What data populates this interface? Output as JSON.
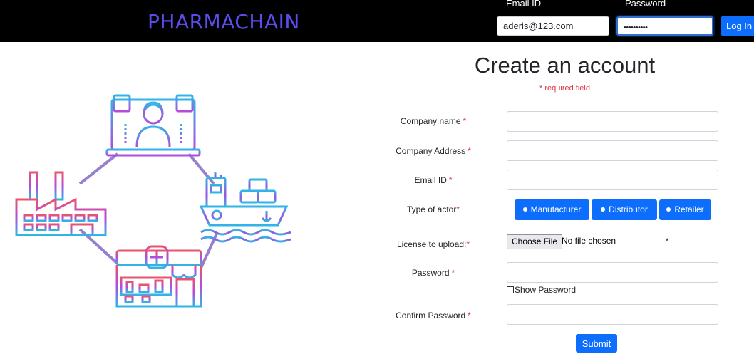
{
  "navbar": {
    "brand": "PHARMACHAIN",
    "email_label": "Email ID",
    "email_value": "aderis@123.com",
    "password_label": "Password",
    "password_value": "••••••••••",
    "login_label": "Log In"
  },
  "form": {
    "title": "Create an account",
    "required_note": "* required field",
    "fields": {
      "company_name": {
        "label": "Company name",
        "star": "*"
      },
      "company_address": {
        "label": "Company Address",
        "star": "*"
      },
      "email": {
        "label": "Email ID",
        "star": "*"
      },
      "actor": {
        "label": "Type of actor",
        "star": "*",
        "options": [
          "Manufacturer",
          "Distributor",
          "Retailer"
        ]
      },
      "license": {
        "label": "License to upload:",
        "star": "*",
        "choose_label": "Choose File",
        "status": "No file chosen",
        "side_star": "*"
      },
      "password": {
        "label": "Password",
        "star": "*",
        "show_label": "Show Password"
      },
      "confirm_password": {
        "label": "Confirm Password",
        "star": "*"
      }
    },
    "submit_label": "Submit"
  },
  "colors": {
    "primary": "#0d6efd",
    "brand": "#5b4cf0",
    "required": "#dc3545",
    "navbar_bg": "#000000"
  },
  "illustration": {
    "icons": [
      "customer-support-icon",
      "factory-icon",
      "cargo-ship-icon",
      "pharmacy-store-icon"
    ]
  }
}
